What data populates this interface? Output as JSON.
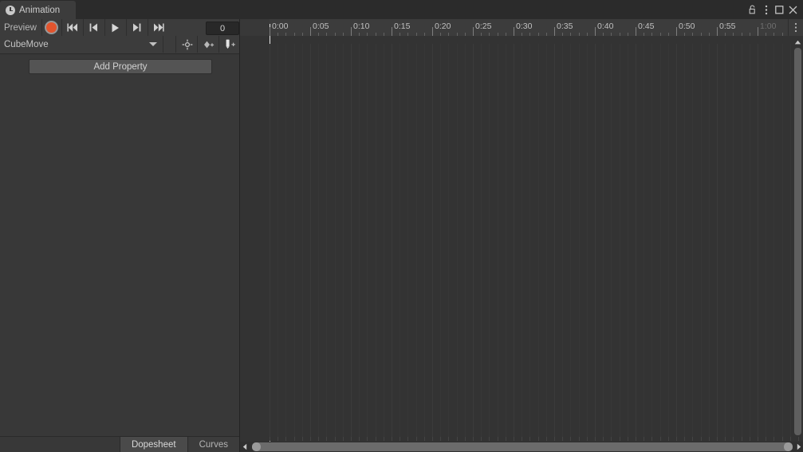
{
  "window": {
    "tab_title": "Animation",
    "tab_icon": "clock-icon",
    "controls": {
      "lock": "lock-icon",
      "menu": "kebab-menu-icon",
      "maximize": "maximize-icon",
      "close": "close-icon"
    }
  },
  "toolbar": {
    "preview_label": "Preview",
    "record_button": "record-icon",
    "first_frame": "skip-to-start-icon",
    "prev_frame": "step-back-icon",
    "play": "play-icon",
    "next_frame": "step-forward-icon",
    "last_frame": "skip-to-end-icon",
    "frame_value": "0"
  },
  "clip": {
    "name": "CubeMove",
    "dropdown_icon": "chevron-down-icon",
    "add_keyframe_icon": "add-keyframe-icon",
    "add_event_icon": "add-event-icon",
    "add_marker_icon": "add-marker-icon"
  },
  "properties": {
    "add_property_label": "Add Property"
  },
  "bottom_tabs": {
    "items": [
      {
        "label": "Dopesheet",
        "active": true
      },
      {
        "label": "Curves",
        "active": false
      }
    ]
  },
  "timeline": {
    "ruler_labels": [
      {
        "text": "0:00",
        "frame": 0,
        "dim": false
      },
      {
        "text": "0:05",
        "frame": 5,
        "dim": false
      },
      {
        "text": "0:10",
        "frame": 10,
        "dim": false
      },
      {
        "text": "0:15",
        "frame": 15,
        "dim": false
      },
      {
        "text": "0:20",
        "frame": 20,
        "dim": false
      },
      {
        "text": "0:25",
        "frame": 25,
        "dim": false
      },
      {
        "text": "0:30",
        "frame": 30,
        "dim": false
      },
      {
        "text": "0:35",
        "frame": 35,
        "dim": false
      },
      {
        "text": "0:40",
        "frame": 40,
        "dim": false
      },
      {
        "text": "0:45",
        "frame": 45,
        "dim": false
      },
      {
        "text": "0:50",
        "frame": 50,
        "dim": false
      },
      {
        "text": "0:55",
        "frame": 55,
        "dim": false
      },
      {
        "text": "1:00",
        "frame": 60,
        "dim": true
      }
    ],
    "playhead_frame": 0,
    "pixels_per_frame": 10.2,
    "ruler_menu_icon": "kebab-menu-icon",
    "scroll_left_icon": "arrow-left-icon",
    "scroll_right_icon": "arrow-right-icon",
    "scroll_up_icon": "arrow-up-icon"
  },
  "colors": {
    "panel_bg": "#383838",
    "toolbar_bg": "#3c3c3c",
    "timeline_bg": "#333333",
    "titlebar_bg": "#2b2b2b",
    "record_accent": "#e2542d",
    "playhead": "#e8e8e8",
    "text": "#b6b6b6"
  }
}
